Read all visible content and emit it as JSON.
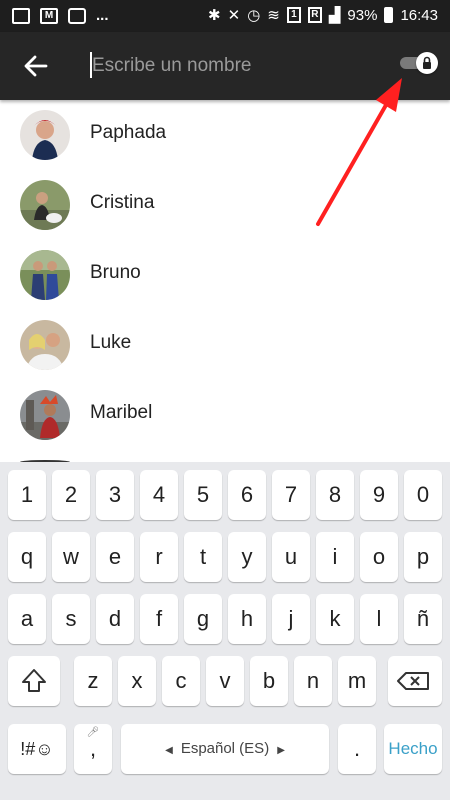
{
  "status_bar": {
    "left_icons": [
      "image-icon",
      "gmail-icon",
      "maps-icon"
    ],
    "more": "...",
    "battery": "93%",
    "time": "16:43",
    "notification_count": "1",
    "signal_label": "R"
  },
  "toolbar": {
    "search_placeholder": "Escribe un nombre",
    "back_icon": "arrow-left-icon",
    "toggle_icon": "lock-icon"
  },
  "contacts": [
    {
      "name": "Paphada"
    },
    {
      "name": "Cristina"
    },
    {
      "name": "Bruno"
    },
    {
      "name": "Luke"
    },
    {
      "name": "Maribel"
    }
  ],
  "keyboard": {
    "row_numbers": [
      "1",
      "2",
      "3",
      "4",
      "5",
      "6",
      "7",
      "8",
      "9",
      "0"
    ],
    "row_1": [
      "q",
      "w",
      "e",
      "r",
      "t",
      "y",
      "u",
      "i",
      "o",
      "p"
    ],
    "row_2": [
      "a",
      "s",
      "d",
      "f",
      "g",
      "h",
      "j",
      "k",
      "l",
      "ñ"
    ],
    "row_3": [
      "z",
      "x",
      "c",
      "v",
      "b",
      "n",
      "m"
    ],
    "symbols_label": "!#☺",
    "comma_label": ",",
    "space_label": "Español (ES)",
    "period_label": ".",
    "done_label": "Hecho"
  },
  "colors": {
    "toolbar": "#262626",
    "status_bar": "#1e1e1e",
    "annotation_arrow": "#ff2020",
    "done_text": "#3aa0c8"
  }
}
